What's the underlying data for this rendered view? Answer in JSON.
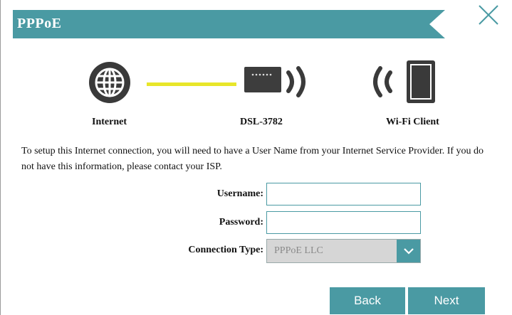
{
  "dialog": {
    "title": "PPPoE"
  },
  "diagram": {
    "nodes": [
      {
        "label": "Internet",
        "icon": "globe-icon"
      },
      {
        "label": "DSL-3782",
        "icon": "router-icon"
      },
      {
        "label": "Wi-Fi Client",
        "icon": "tablet-icon"
      }
    ],
    "link_color": "#e8e62a"
  },
  "description": "To setup this Internet connection, you will need to have a User Name from your Internet Service Provider. If you do not have this information, please contact your ISP.",
  "form": {
    "username": {
      "label": "Username:",
      "value": ""
    },
    "password": {
      "label": "Password:",
      "value": ""
    },
    "connection_type": {
      "label": "Connection Type:",
      "selected": "PPPoE LLC"
    }
  },
  "buttons": {
    "back": "Back",
    "next": "Next"
  },
  "colors": {
    "accent": "#4a9aa3",
    "link": "#e8e62a"
  }
}
